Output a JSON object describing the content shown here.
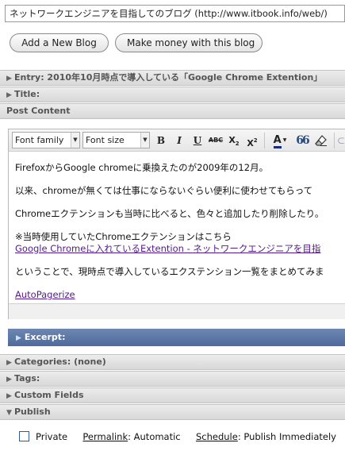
{
  "browser": {
    "url_text": "ネットワークエンジニアを目指してのブログ (http://www.itbook.info/web/)"
  },
  "buttons": {
    "add_new_blog": "Add a New Blog",
    "make_money": "Make money with this blog"
  },
  "panels": {
    "entry": "Entry: 2010年10月時点で導入している「Google Chrome Extention」",
    "title": "Title:",
    "post_content": "Post Content",
    "excerpt": "Excerpt:",
    "categories": "Categories: (none)",
    "tags": "Tags:",
    "custom_fields": "Custom Fields",
    "publish": "Publish"
  },
  "toolbar": {
    "font_family": "Font family",
    "font_size": "Font size",
    "bold": "B",
    "italic": "I",
    "underline": "U",
    "strikethrough": "ABC",
    "subscript": "X",
    "superscript": "X",
    "subscript_mark": "2",
    "superscript_mark": "2",
    "font_color": "A",
    "quote": "66"
  },
  "post": {
    "p1": "FirefoxからGoogle chromeに乗換えたのが2009年の12月。",
    "p2": "以来、chromeが無くては仕事にならないぐらい便利に使わせてもらって",
    "p3": "Chromeエクテンションも当時に比べると、色々と追加したり削除したり。",
    "p4_text": "※当時使用していたChromeエクテンションはこちら",
    "p4_link": "Google Chromeに入れているExtention - ネットワークエンジニアを目指",
    "p5": "ということで、現時点で導入しているエクステンション一覧をまとめてみま",
    "p6_link": "AutoPagerize"
  },
  "publish": {
    "private_label": "Private",
    "permalink_label": "Permalink",
    "permalink_value": ": Automatic",
    "schedule_label": "Schedule",
    "schedule_value": ": Publish Immediately"
  },
  "colors": {
    "excerpt_bar": "#5b75a5",
    "link": "#551a8b"
  }
}
